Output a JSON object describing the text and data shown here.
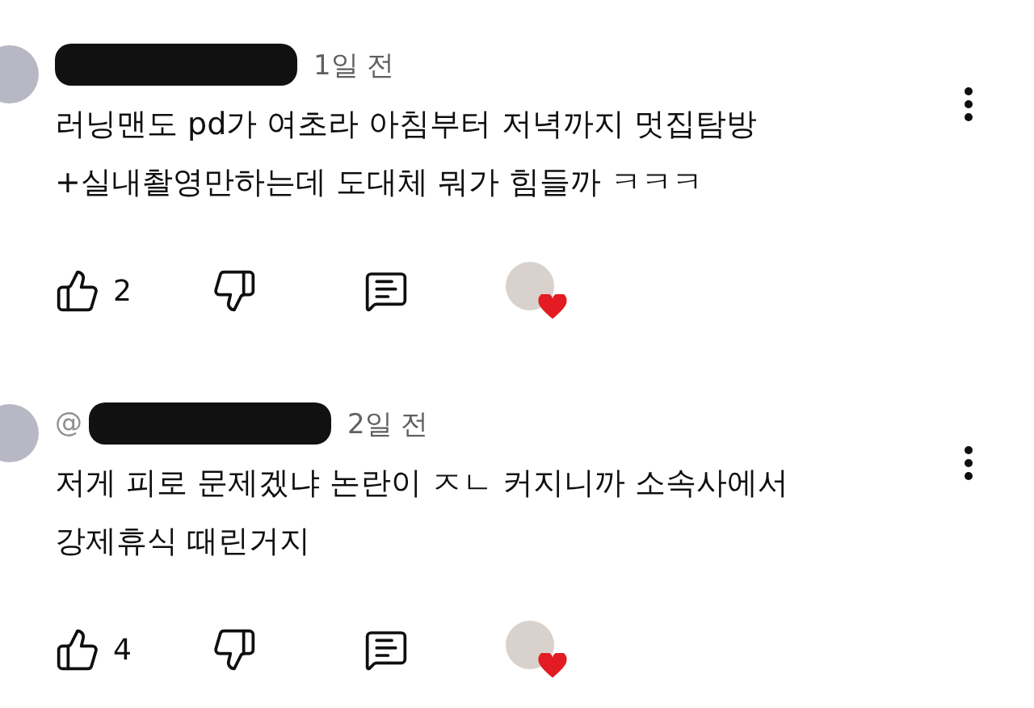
{
  "comments": [
    {
      "handle_redacted": true,
      "time": "1일 전",
      "text": "러닝맨도 pd가 여초라 아침부터 저녁까지 멋집탐방+실내촬영만하는데 도대체 뭐가 힘들까 ㅋㅋㅋ",
      "likes": "2",
      "hearted": true
    },
    {
      "handle_visible": "@",
      "handle_redacted": true,
      "time": "2일 전",
      "text": "저게 피로 문제겠냐 논란이 ㅈㄴ 커지니까 소속사에서 강제휴식 때린거지",
      "likes": "4",
      "hearted": true
    }
  ]
}
